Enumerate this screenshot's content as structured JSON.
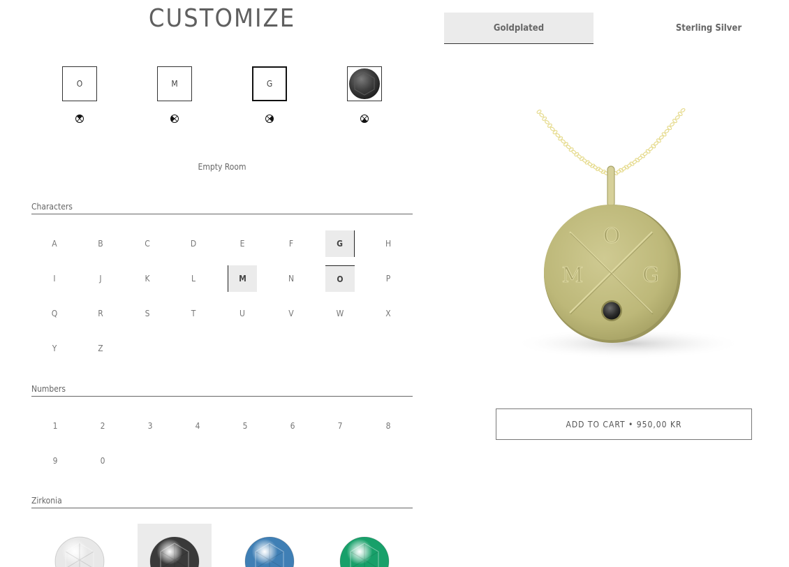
{
  "page": {
    "title": "CUSTOMIZE"
  },
  "tabs": [
    {
      "label": "Goldplated",
      "selected": true
    },
    {
      "label": "Sterling Silver",
      "selected": false
    }
  ],
  "slots": [
    {
      "label": "O",
      "type": "letter",
      "active": false
    },
    {
      "label": "M",
      "type": "letter",
      "active": false
    },
    {
      "label": "G",
      "type": "letter",
      "active": true
    },
    {
      "label": "",
      "type": "gem",
      "gem": "black-zirconia",
      "active": false
    }
  ],
  "room_label": "Empty Room",
  "characters": {
    "heading": "Characters",
    "items": [
      "A",
      "B",
      "C",
      "D",
      "E",
      "F",
      "G",
      "H",
      "I",
      "J",
      "K",
      "L",
      "M",
      "N",
      "O",
      "P",
      "Q",
      "R",
      "S",
      "T",
      "U",
      "V",
      "W",
      "X",
      "Y",
      "Z"
    ],
    "selected": [
      "G",
      "M",
      "O"
    ]
  },
  "numbers": {
    "heading": "Numbers",
    "items": [
      "1",
      "2",
      "3",
      "4",
      "5",
      "6",
      "7",
      "8",
      "9",
      "0"
    ]
  },
  "zirkonia": {
    "heading": "Zirkonia",
    "items": [
      {
        "name": "white-zirconia",
        "color": "#e8e8e8",
        "selected": false
      },
      {
        "name": "black-zirconia",
        "color": "#3a3a3a",
        "selected": true
      },
      {
        "name": "blue-zirconia",
        "color": "#3f7fb5",
        "selected": false
      },
      {
        "name": "green-zirconia",
        "color": "#18a06a",
        "selected": false
      }
    ]
  },
  "product": {
    "engraving": {
      "top": "O",
      "left": "M",
      "right": "G"
    },
    "metal_color": "#c2bd84",
    "chain_color": "#e6db8e"
  },
  "cart": {
    "label": "ADD TO CART • 950,00 KR"
  }
}
